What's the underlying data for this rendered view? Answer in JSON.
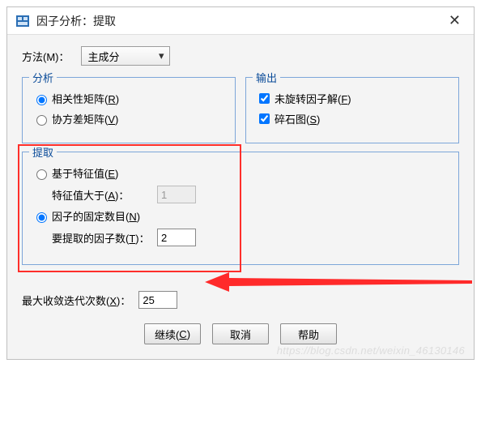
{
  "title": "因子分析：提取",
  "close_glyph": "✕",
  "method": {
    "label": "方法(M)：",
    "value": "主成分",
    "caret": "▾"
  },
  "analysis": {
    "legend": "分析",
    "corr": "相关性矩阵(",
    "corr_u": "R",
    "corr_end": ")",
    "cov": "协方差矩阵(",
    "cov_u": "V",
    "cov_end": ")"
  },
  "output": {
    "legend": "输出",
    "unrotated": "未旋转因子解(",
    "unrotated_u": "F",
    "unrotated_end": ")",
    "scree": "碎石图(",
    "scree_u": "S",
    "scree_end": ")"
  },
  "extract": {
    "legend": "提取",
    "eigen": "基于特征值(",
    "eigen_u": "E",
    "eigen_end": ")",
    "eigen_gt": "特征值大于(",
    "eigen_gt_u": "A",
    "eigen_gt_end": ")：",
    "eigen_value": "1",
    "fixed": "因子的固定数目(",
    "fixed_u": "N",
    "fixed_end": ")",
    "to_extract": "要提取的因子数(",
    "to_extract_u": "T",
    "to_extract_end": ")：",
    "to_extract_value": "2"
  },
  "iter": {
    "label": "最大收敛迭代次数(",
    "label_u": "X",
    "label_end": ")：",
    "value": "25"
  },
  "buttons": {
    "continue": "继续(",
    "continue_u": "C",
    "continue_end": ")",
    "cancel": "取消",
    "help": "帮助"
  },
  "watermark": "https://blog.csdn.net/weixin_46130146"
}
